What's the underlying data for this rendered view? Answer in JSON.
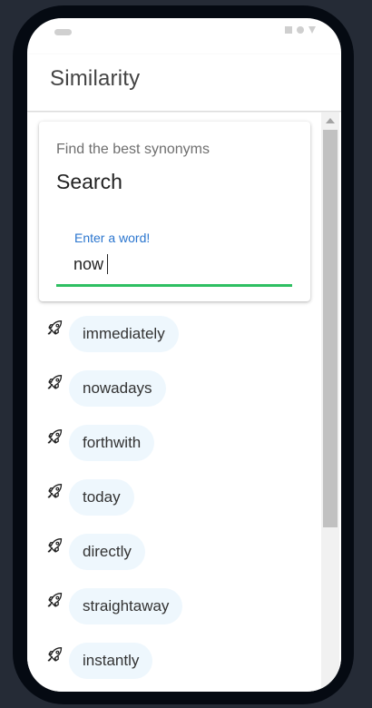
{
  "appbar": {
    "title": "Similarity"
  },
  "card": {
    "subtitle": "Find the best synonyms",
    "title": "Search",
    "field_label": "Enter a word!",
    "field_value": "now"
  },
  "results": [
    {
      "word": "immediately",
      "icon": "rocket-icon"
    },
    {
      "word": "nowadays",
      "icon": "rocket-icon"
    },
    {
      "word": "forthwith",
      "icon": "rocket-icon"
    },
    {
      "word": "today",
      "icon": "rocket-icon"
    },
    {
      "word": "directly",
      "icon": "rocket-icon"
    },
    {
      "word": "straightaway",
      "icon": "rocket-icon"
    },
    {
      "word": "instantly",
      "icon": "rocket-icon"
    }
  ],
  "colors": {
    "accent_label": "#2b76cf",
    "underline_active": "#2fbf62",
    "chip_background": "#eef7fd"
  }
}
